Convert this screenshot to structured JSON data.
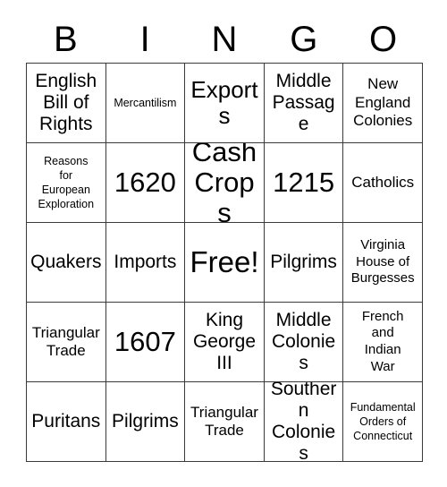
{
  "card": {
    "header_letters": [
      "B",
      "I",
      "N",
      "G",
      "O"
    ],
    "columns": 5,
    "rows": 5,
    "border_color": "#3a3a3a",
    "background_color": "#ffffff",
    "text_color": "#000000",
    "free_space": {
      "row": 3,
      "column": 3,
      "label": "Free!"
    },
    "cells": [
      {
        "text": "English\nBill of\nRights",
        "size": "lg"
      },
      {
        "text": "Mercantilism",
        "size": "xs"
      },
      {
        "text": "Exports",
        "size": "xl"
      },
      {
        "text": "Middle\nPassage",
        "size": "lg"
      },
      {
        "text": "New\nEngland\nColonies",
        "size": "md"
      },
      {
        "text": "Reasons\nfor\nEuropean\nExploration",
        "size": "xs"
      },
      {
        "text": "1620",
        "size": "xxl"
      },
      {
        "text": "Cash\nCrops",
        "size": "xxl"
      },
      {
        "text": "1215",
        "size": "xxl"
      },
      {
        "text": "Catholics",
        "size": "md"
      },
      {
        "text": "Quakers",
        "size": "lg"
      },
      {
        "text": "Imports",
        "size": "lg"
      },
      {
        "text": "Free!",
        "size": "free"
      },
      {
        "text": "Pilgrims",
        "size": "lg"
      },
      {
        "text": "Virginia\nHouse of\nBurgesses",
        "size": "sm"
      },
      {
        "text": "Triangular\nTrade",
        "size": "md"
      },
      {
        "text": "1607",
        "size": "xxl"
      },
      {
        "text": "King\nGeorge\nIII",
        "size": "lg"
      },
      {
        "text": "Middle\nColonies",
        "size": "lg"
      },
      {
        "text": "French\nand\nIndian\nWar",
        "size": "sm"
      },
      {
        "text": "Puritans",
        "size": "lg"
      },
      {
        "text": "Pilgrims",
        "size": "lg"
      },
      {
        "text": "Triangular\nTrade",
        "size": "md"
      },
      {
        "text": "Southern\nColonies",
        "size": "lg"
      },
      {
        "text": "Fundamental\nOrders of\nConnecticut",
        "size": "xs"
      }
    ]
  }
}
